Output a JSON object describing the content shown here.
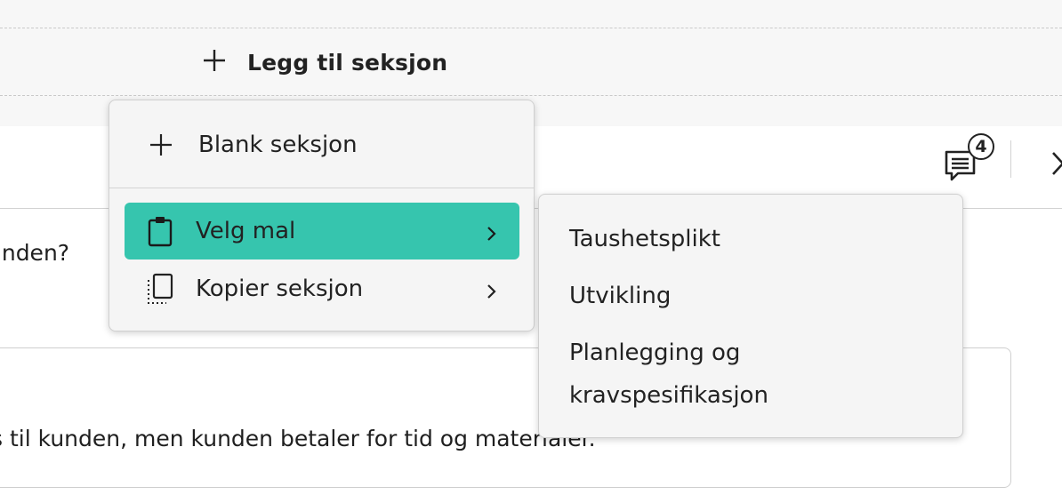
{
  "add_section": {
    "label": "Legg til seksjon",
    "icon": "plus-icon"
  },
  "header": {
    "comment_count": "4",
    "comment_icon": "comment-icon",
    "close_icon": "close-icon"
  },
  "question": {
    "text": "unden?"
  },
  "answer": {
    "text": "s til kunden, men kunden betaler for tid og materialer."
  },
  "menu": {
    "items": [
      {
        "label": "Blank seksjon",
        "icon": "plus-icon",
        "has_submenu": false
      },
      {
        "label": "Velg mal",
        "icon": "clipboard-icon",
        "has_submenu": true,
        "active": true
      },
      {
        "label": "Kopier seksjon",
        "icon": "copy-icon",
        "has_submenu": true
      }
    ],
    "active_color": "#36c5ae"
  },
  "submenu": {
    "items": [
      {
        "label": "Taushetsplikt"
      },
      {
        "label": "Utvikling"
      },
      {
        "label": "Planlegging og kravspesifikasjon"
      }
    ]
  }
}
